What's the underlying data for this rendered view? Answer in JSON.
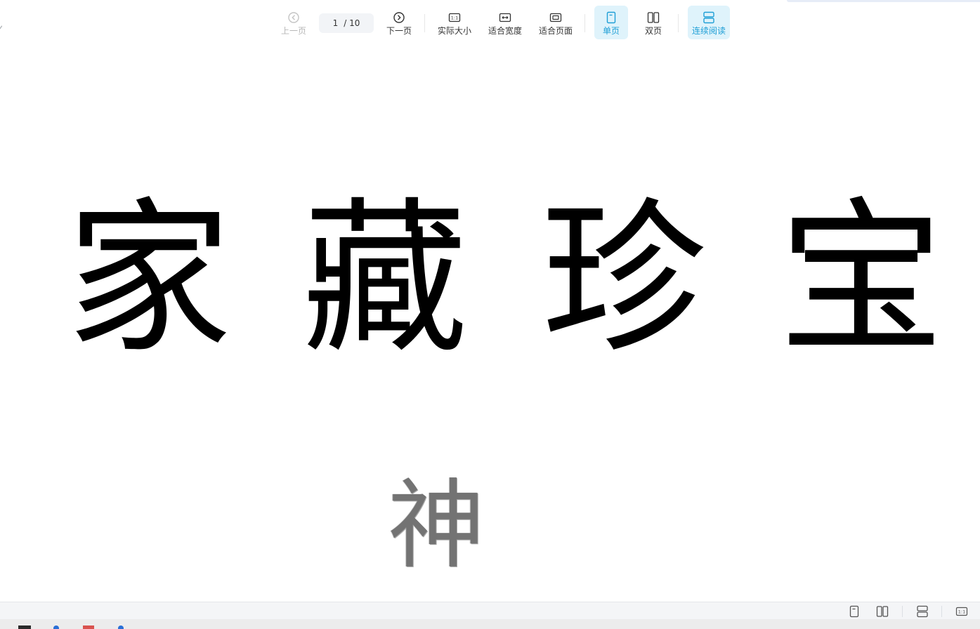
{
  "toolbar": {
    "prev_label": "上一页",
    "next_label": "下一页",
    "page_current": "1",
    "page_total": "/ 10",
    "actual_size_label": "实际大小",
    "fit_width_label": "适合宽度",
    "fit_page_label": "适合页面",
    "single_page_label": "单页",
    "double_page_label": "双页",
    "continuous_label": "连续阅读",
    "accent_color": "#1f9fd6"
  },
  "document": {
    "title_chars": [
      "家",
      "藏",
      "珍",
      "宝"
    ],
    "seal_char": "神"
  }
}
